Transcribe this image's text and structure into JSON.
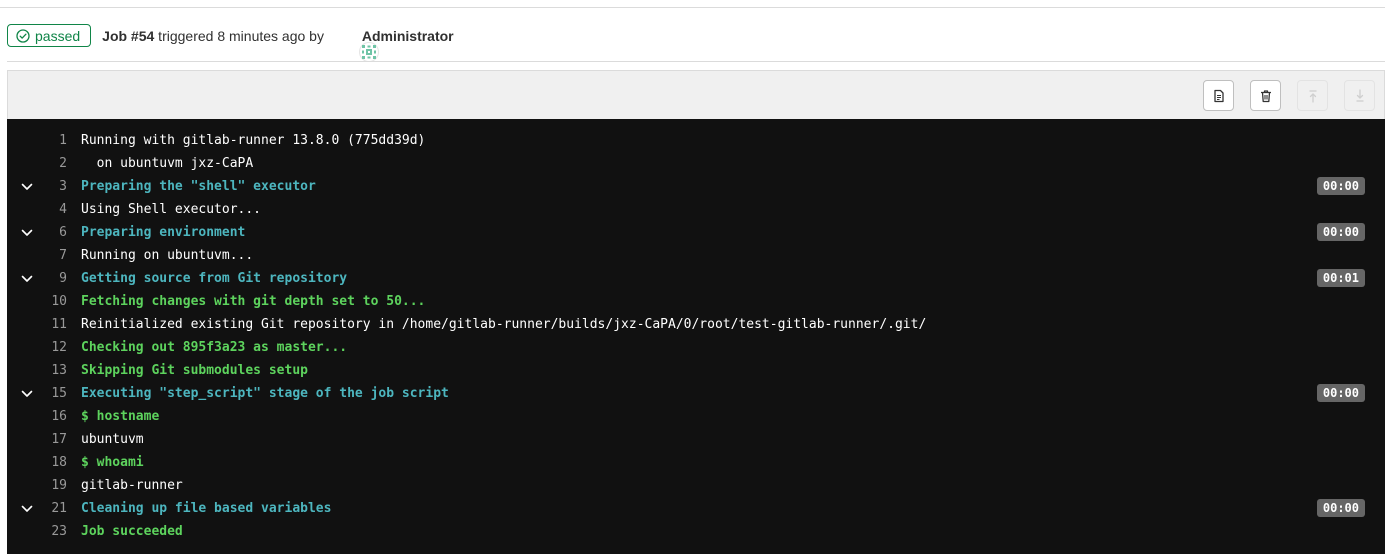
{
  "header": {
    "status_label": "passed",
    "status_icon": "status-success-icon",
    "job_label": "Job #54",
    "triggered_text": " triggered 8 minutes ago by ",
    "user_name": "Administrator",
    "status_color": "#108548"
  },
  "toolbar": {
    "buttons": [
      {
        "name": "show-raw-icon",
        "state": "enabled"
      },
      {
        "name": "erase-log-icon",
        "state": "enabled"
      },
      {
        "name": "scroll-top-icon",
        "state": "disabled"
      },
      {
        "name": "scroll-bottom-icon",
        "state": "disabled"
      }
    ]
  },
  "log": {
    "lines": [
      {
        "num": "1",
        "text": "Running with gitlab-runner 13.8.0 (775dd39d)",
        "style": "white",
        "section": false,
        "duration": ""
      },
      {
        "num": "2",
        "text": "  on ubuntuvm jxz-CaPA",
        "style": "white",
        "section": false,
        "duration": ""
      },
      {
        "num": "3",
        "text": "Preparing the \"shell\" executor",
        "style": "cyan",
        "section": true,
        "duration": "00:00"
      },
      {
        "num": "4",
        "text": "Using Shell executor...",
        "style": "white",
        "section": false,
        "duration": ""
      },
      {
        "num": "6",
        "text": "Preparing environment",
        "style": "cyan",
        "section": true,
        "duration": "00:00"
      },
      {
        "num": "7",
        "text": "Running on ubuntuvm...",
        "style": "white",
        "section": false,
        "duration": ""
      },
      {
        "num": "9",
        "text": "Getting source from Git repository",
        "style": "cyan",
        "section": true,
        "duration": "00:01"
      },
      {
        "num": "10",
        "text": "Fetching changes with git depth set to 50...",
        "style": "green",
        "section": false,
        "duration": ""
      },
      {
        "num": "11",
        "text": "Reinitialized existing Git repository in /home/gitlab-runner/builds/jxz-CaPA/0/root/test-gitlab-runner/.git/",
        "style": "white",
        "section": false,
        "duration": ""
      },
      {
        "num": "12",
        "text": "Checking out 895f3a23 as master...",
        "style": "green",
        "section": false,
        "duration": ""
      },
      {
        "num": "13",
        "text": "Skipping Git submodules setup",
        "style": "green",
        "section": false,
        "duration": ""
      },
      {
        "num": "15",
        "text": "Executing \"step_script\" stage of the job script",
        "style": "cyan",
        "section": true,
        "duration": "00:00"
      },
      {
        "num": "16",
        "text": "$ hostname",
        "style": "green",
        "section": false,
        "duration": ""
      },
      {
        "num": "17",
        "text": "ubuntuvm",
        "style": "white",
        "section": false,
        "duration": ""
      },
      {
        "num": "18",
        "text": "$ whoami",
        "style": "green",
        "section": false,
        "duration": ""
      },
      {
        "num": "19",
        "text": "gitlab-runner",
        "style": "white",
        "section": false,
        "duration": ""
      },
      {
        "num": "21",
        "text": "Cleaning up file based variables",
        "style": "cyan",
        "section": true,
        "duration": "00:00"
      },
      {
        "num": "23",
        "text": "Job succeeded",
        "style": "green",
        "section": false,
        "duration": ""
      }
    ]
  }
}
